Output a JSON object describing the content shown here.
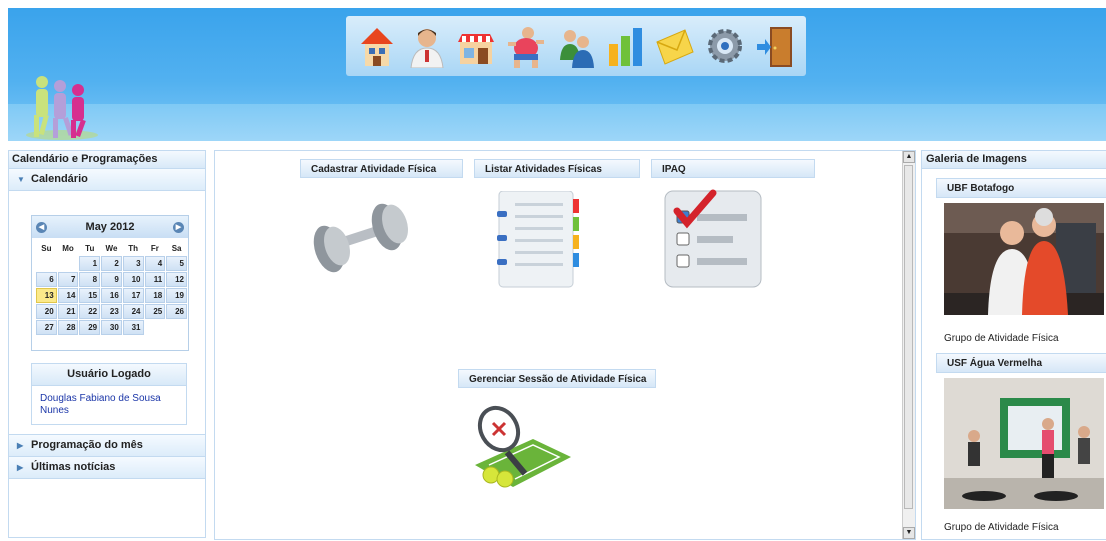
{
  "toolbar": {
    "icons": [
      "home-icon",
      "user-icon",
      "stores-icon",
      "runner-icon",
      "users-group-icon",
      "bar-chart-icon",
      "mail-icon",
      "settings-gear-icon",
      "exit-door-icon"
    ]
  },
  "left": {
    "header": "Calendário e Programações",
    "calendar_section": "Calendário",
    "calendar": {
      "month": "May 2012",
      "weekdays": [
        "Su",
        "Mo",
        "Tu",
        "We",
        "Th",
        "Fr",
        "Sa"
      ],
      "weeks": [
        [
          "",
          "",
          "1",
          "2",
          "3",
          "4",
          "5"
        ],
        [
          "6",
          "7",
          "8",
          "9",
          "10",
          "11",
          "12"
        ],
        [
          "13",
          "14",
          "15",
          "16",
          "17",
          "18",
          "19"
        ],
        [
          "20",
          "21",
          "22",
          "23",
          "24",
          "25",
          "26"
        ],
        [
          "27",
          "28",
          "29",
          "30",
          "31",
          "",
          ""
        ]
      ],
      "today": "13"
    },
    "user_box": {
      "title": "Usuário Logado",
      "name": "Douglas Fabiano de Sousa Nunes"
    },
    "sections": [
      "Programação do mês",
      "Últimas notícias"
    ]
  },
  "center": {
    "tiles": {
      "cadastrar": "Cadastrar Atividade Física",
      "listar": "Listar Atividades Físicas",
      "ipaq": "IPAQ",
      "gerenciar": "Gerenciar Sessão de Atividade Física"
    }
  },
  "right": {
    "header": "Galeria de Imagens",
    "galleries": [
      {
        "title": "UBF Botafogo",
        "caption": "Grupo de Atividade Física"
      },
      {
        "title": "USF Água Vermelha",
        "caption": "Grupo de Atividade Física"
      }
    ]
  },
  "colors": {
    "header_blue": "#3aa3ec",
    "panel_border": "#c3daf0",
    "today": "#fbe98a",
    "link": "#1b36a8"
  }
}
